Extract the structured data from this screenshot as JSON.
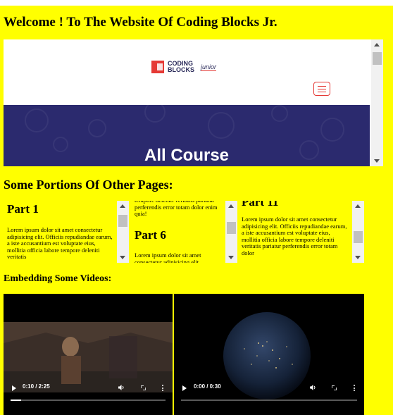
{
  "page": {
    "title": "Welcome ! To The Website Of Coding Blocks Jr.",
    "background": "#ffff00",
    "portions_heading": "Some Portions Of Other Pages:",
    "videos_heading": "Embedding Some Videos:"
  },
  "main_frame": {
    "logo_line1": "CODING",
    "logo_line2": "BLOCKS",
    "logo_jr": "junior",
    "menu_icon": "hamburger-icon",
    "hero_title": "All Course",
    "hero_color": "#2b2a6e",
    "accent": "#e53935"
  },
  "frames": [
    {
      "heading": "Part 1",
      "text": "Lorem ipsum dolor sit amet consectetur adipisicing elit. Officiis repudiandae earum, a iste accusantium est voluptate eius, mollitia officia labore tempore deleniti veritatis"
    },
    {
      "top_text": "tempore deleniti veritatis pariatur perferendis error totam dolor enim quia!",
      "heading": "Part 6",
      "text": "Lorem ipsum dolor sit amet consectetur adipisicing elit."
    },
    {
      "heading": "Part 11",
      "text": "Lorem ipsum dolor sit amet consectetur adipisicing elit. Officiis repudiandae earum, a iste accusantium est voluptate eius, mollitia officia labore tempore deleniti veritatis pariatur perferendis error totam dolor"
    }
  ],
  "videos": [
    {
      "time": "0:10 / 2:25",
      "progress": 0.07
    },
    {
      "time": "0:00 / 0:30",
      "progress": 0.0
    }
  ]
}
